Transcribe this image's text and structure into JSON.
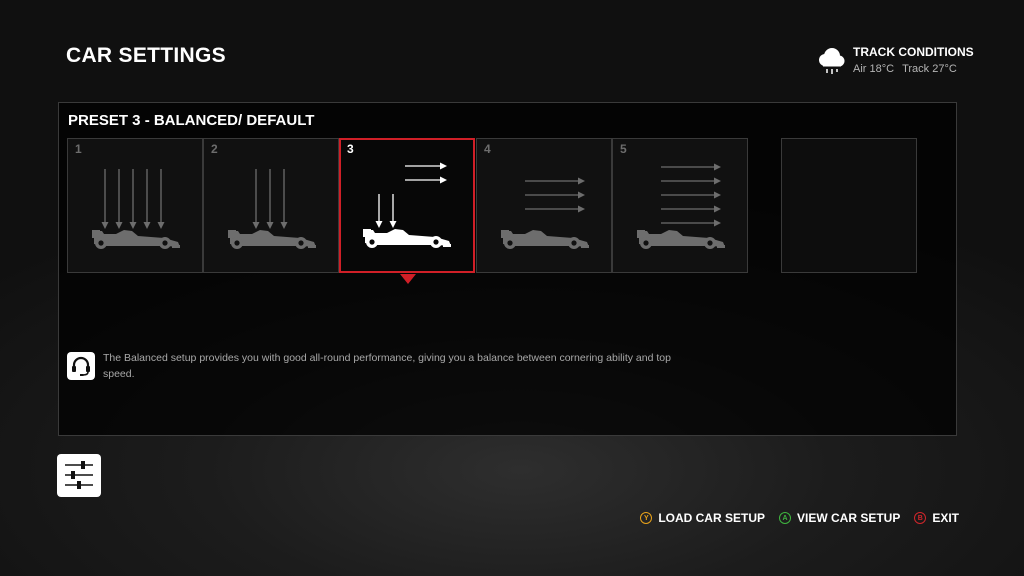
{
  "header": {
    "title": "CAR SETTINGS",
    "track_conditions": {
      "icon": "cloud-rain-icon",
      "title": "TRACK CONDITIONS",
      "air": "Air 18°C",
      "track": "Track 27°C"
    }
  },
  "preset": {
    "title": "PRESET 3 - BALANCED/ DEFAULT",
    "selected": 3,
    "cards": [
      {
        "number": "1",
        "down_arrows": 5,
        "side_arrows": 0
      },
      {
        "number": "2",
        "down_arrows": 3,
        "side_arrows": 0
      },
      {
        "number": "3",
        "down_arrows": 2,
        "side_arrows": 2
      },
      {
        "number": "4",
        "down_arrows": 0,
        "side_arrows": 3
      },
      {
        "number": "5",
        "down_arrows": 0,
        "side_arrows": 5
      }
    ],
    "description": "The Balanced setup provides you with good all-round performance, giving you a balance between cornering ability and top speed."
  },
  "footer": {
    "buttons": [
      {
        "key": "Y",
        "label": "LOAD CAR SETUP",
        "color": "#e8a21a"
      },
      {
        "key": "A",
        "label": "VIEW CAR SETUP",
        "color": "#3fb53f"
      },
      {
        "key": "B",
        "label": "EXIT",
        "color": "#d0262b"
      }
    ]
  },
  "colors": {
    "accent": "#d01f27",
    "dim": "#6d6d6d"
  }
}
